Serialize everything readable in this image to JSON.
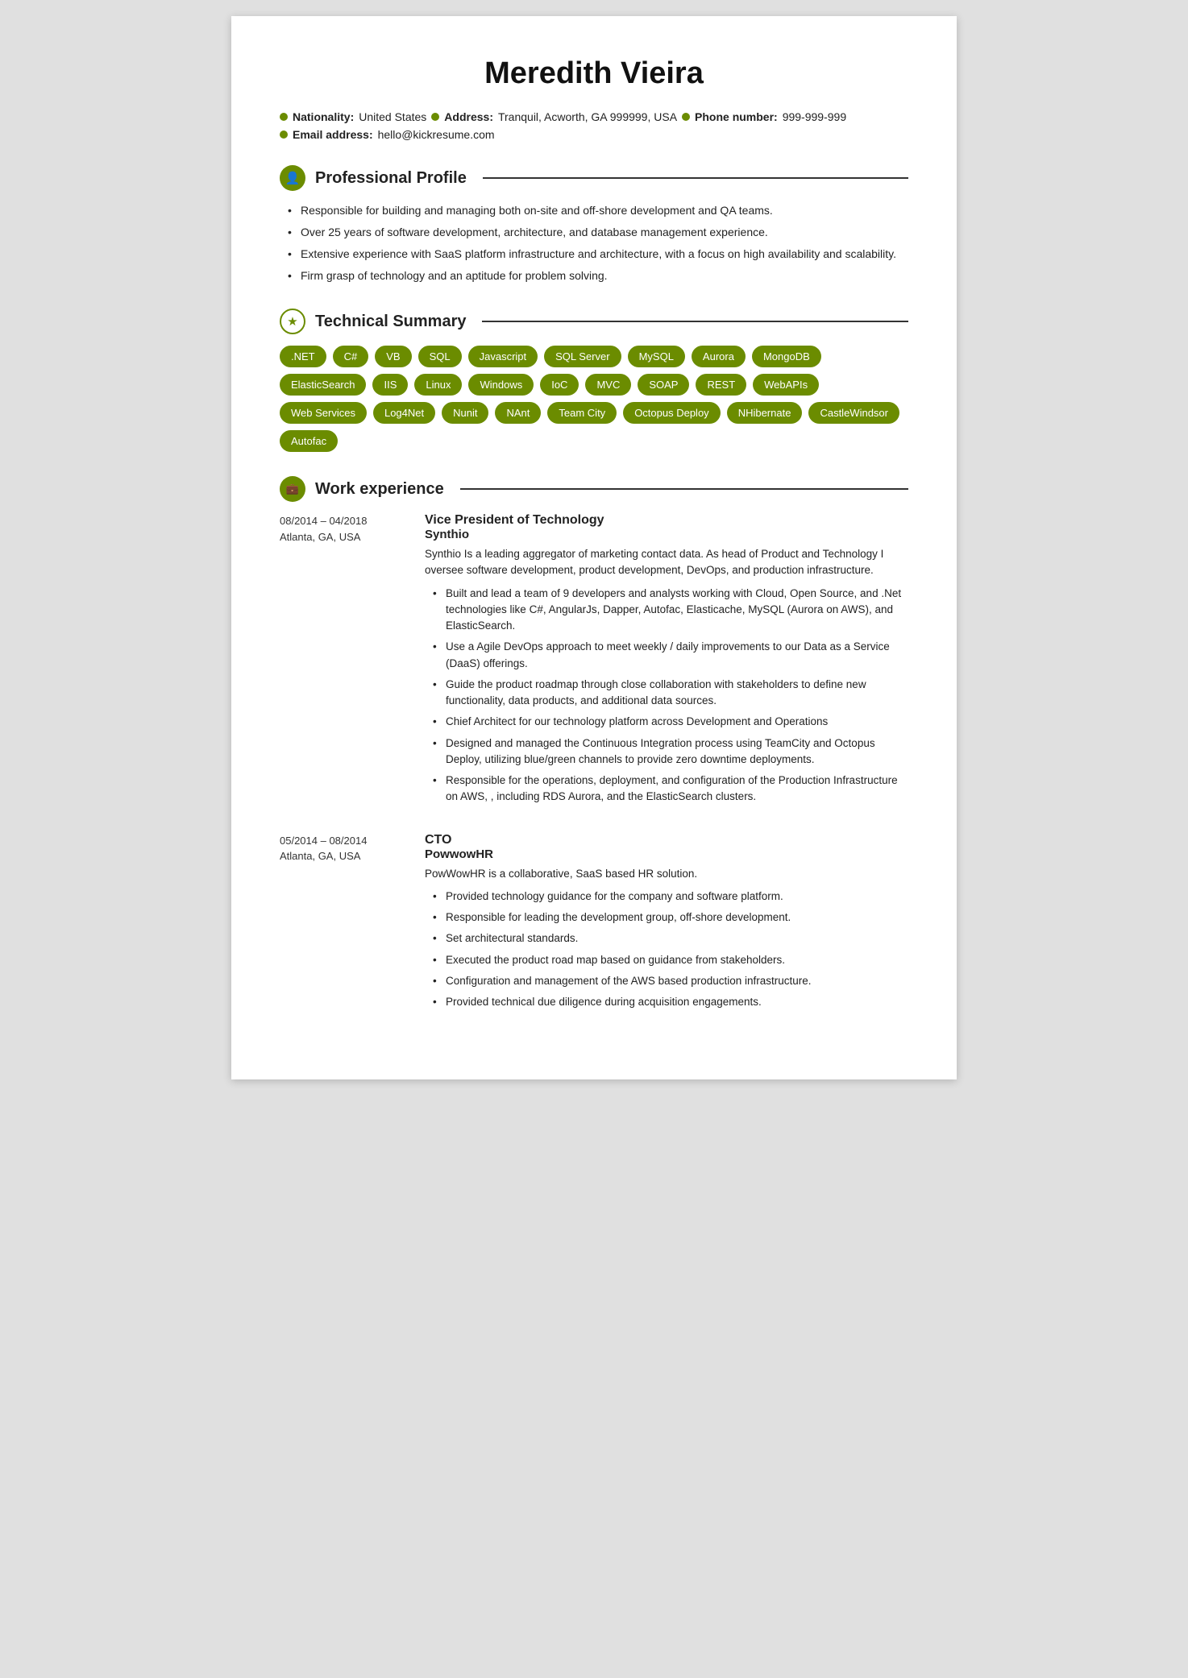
{
  "resume": {
    "name": "Meredith Vieira",
    "contact": {
      "row1": [
        {
          "label": "Nationality:",
          "value": "United States"
        },
        {
          "label": "Address:",
          "value": "Tranquil, Acworth, GA 999999, USA"
        },
        {
          "label": "Phone number:",
          "value": "999-999-999"
        }
      ],
      "row2": [
        {
          "label": "Email address:",
          "value": "hello@kickresume.com"
        }
      ]
    },
    "sections": {
      "professional_profile": {
        "title": "Professional Profile",
        "icon": "person",
        "bullets": [
          "Responsible for building and managing both on-site and off-shore development and QA teams.",
          "Over 25 years of software development, architecture, and database management experience.",
          "Extensive experience with SaaS platform infrastructure and architecture, with a focus on high availability and scalability.",
          "Firm grasp of technology and an aptitude for problem solving."
        ]
      },
      "technical_summary": {
        "title": "Technical Summary",
        "icon": "star",
        "tags": [
          ".NET",
          "C#",
          "VB",
          "SQL",
          "Javascript",
          "SQL Server",
          "MySQL",
          "Aurora",
          "MongoDB",
          "ElasticSearch",
          "IIS",
          "Linux",
          "Windows",
          "IoC",
          "MVC",
          "SOAP",
          "REST",
          "WebAPIs",
          "Web Services",
          "Log4Net",
          "Nunit",
          "NAnt",
          "Team City",
          "Octopus Deploy",
          "NHibernate",
          "CastleWindsor",
          "Autofac"
        ]
      },
      "work_experience": {
        "title": "Work experience",
        "icon": "briefcase",
        "entries": [
          {
            "dates": "08/2014 – 04/2018",
            "location": "Atlanta, GA, USA",
            "job_title": "Vice President of Technology",
            "company": "Synthio",
            "description": "Synthio Is a leading aggregator of marketing contact data. As head of Product and Technology I oversee software development, product development, DevOps, and production infrastructure.",
            "bullets": [
              "Built and lead a team of 9 developers and analysts working with Cloud, Open Source, and .Net technologies like C#, AngularJs, Dapper, Autofac, Elasticache, MySQL (Aurora on AWS), and ElasticSearch.",
              "Use a Agile DevOps approach to meet weekly / daily improvements to our Data as a Service (DaaS) offerings.",
              "Guide the product roadmap through close collaboration with stakeholders to define new functionality, data products, and additional data sources.",
              "Chief Architect for our technology platform across Development and Operations",
              "Designed and managed the Continuous Integration process using TeamCity and Octopus Deploy, utilizing blue/green channels to provide zero downtime deployments.",
              "Responsible for the operations, deployment, and configuration of the Production Infrastructure on AWS, , including RDS Aurora, and the  ElasticSearch clusters."
            ]
          },
          {
            "dates": "05/2014 – 08/2014",
            "location": "Atlanta, GA, USA",
            "job_title": "CTO",
            "company": "PowwowHR",
            "description": "PowWowHR is a collaborative, SaaS based HR solution.",
            "bullets": [
              "Provided technology guidance for the company and software platform.",
              "Responsible for leading the development group, off-shore development.",
              "Set architectural standards.",
              "Executed the product road map based on guidance from stakeholders.",
              "Configuration and management of the AWS based production infrastructure.",
              "Provided technical due diligence during acquisition engagements."
            ]
          }
        ]
      }
    }
  }
}
